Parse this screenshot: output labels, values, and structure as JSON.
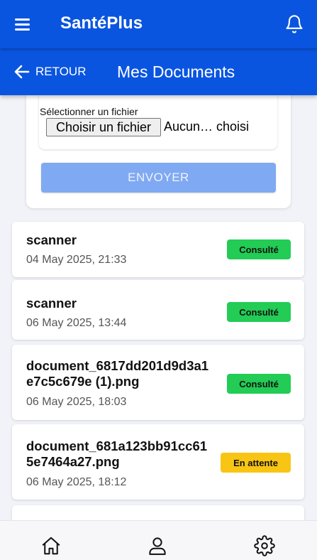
{
  "header": {
    "app_title": "SantéPlus"
  },
  "subheader": {
    "back_label": "RETOUR",
    "title": "Mes Documents"
  },
  "upload": {
    "file_label": "Sélectionner un fichier",
    "file_button": "Choisir un fichier",
    "file_status": "Aucun… choisi",
    "send_label": "ENVOYER"
  },
  "documents": [
    {
      "name": "scanner",
      "date": "04 May 2025, 21:33",
      "status": "Consulté"
    },
    {
      "name": "scanner",
      "date": "06 May 2025, 13:44",
      "status": "Consulté"
    },
    {
      "name": "document_6817dd201d9d3a1e7c5c679e (1).png",
      "date": "06 May 2025, 18:03",
      "status": "Consulté"
    },
    {
      "name": "document_681a123bb91cc615e7464a27.png",
      "date": "06 May 2025, 18:12",
      "status": "En attente"
    }
  ],
  "colors": {
    "primary": "#0a55e0",
    "seen": "#22cc55",
    "pending": "#f8c514",
    "send_disabled": "#7fa9f2"
  },
  "nav": {
    "icons": [
      "home-icon",
      "user-icon",
      "settings-icon"
    ]
  }
}
